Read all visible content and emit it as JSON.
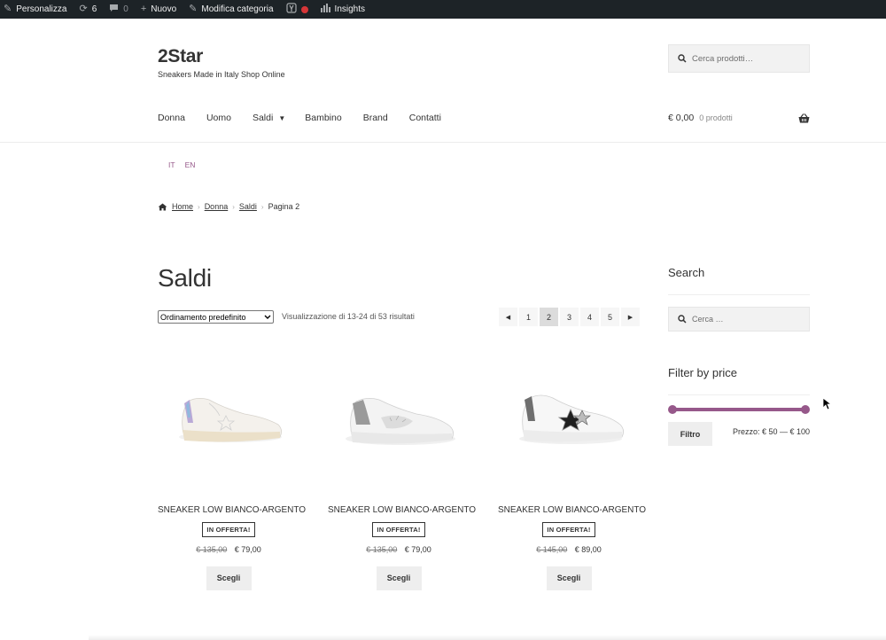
{
  "adminbar": {
    "customize": "Personalizza",
    "updates": "6",
    "comments": "0",
    "new": "Nuovo",
    "edit_category": "Modifica categoria",
    "insights": "Insights"
  },
  "site": {
    "title": "2Star",
    "tagline": "Sneakers Made in Italy Shop Online"
  },
  "header_search": {
    "placeholder": "Cerca prodotti…"
  },
  "nav": {
    "items": [
      "Donna",
      "Uomo",
      "Saldi",
      "Bambino",
      "Brand",
      "Contatti"
    ]
  },
  "cart": {
    "amount": "€ 0,00",
    "count": "0 prodotti"
  },
  "languages": [
    "IT",
    "EN"
  ],
  "breadcrumb": {
    "home": "Home",
    "donna": "Donna",
    "saldi": "Saldi",
    "current": "Pagina 2"
  },
  "page": {
    "title": "Saldi"
  },
  "ordering": {
    "selected": "Ordinamento predefinito"
  },
  "results": "Visualizzazione di 13-24 di 53 risultati",
  "pagination": {
    "pages": [
      "1",
      "2",
      "3",
      "4",
      "5"
    ],
    "current": "2"
  },
  "sidebar": {
    "search_title": "Search",
    "search_placeholder": "Cerca …",
    "filter_title": "Filter by price",
    "filter_button": "Filtro",
    "price_range": "Prezzo: € 50 — € 100",
    "range_min_fraction": 0,
    "range_max_fraction": 1
  },
  "products": [
    {
      "name": "SNEAKER LOW BIANCO-ARGENTO",
      "badge": "IN OFFERTA!",
      "old_price": "€ 135,00",
      "price": "€ 79,00",
      "button": "Scegli"
    },
    {
      "name": "SNEAKER LOW BIANCO-ARGENTO",
      "badge": "IN OFFERTA!",
      "old_price": "€ 135,00",
      "price": "€ 79,00",
      "button": "Scegli"
    },
    {
      "name": "SNEAKER LOW BIANCO-ARGENTO",
      "badge": "IN OFFERTA!",
      "old_price": "€ 145,00",
      "price": "€ 89,00",
      "button": "Scegli"
    }
  ],
  "colors": {
    "accent": "#96588a",
    "adminbar": "#1d2327"
  }
}
